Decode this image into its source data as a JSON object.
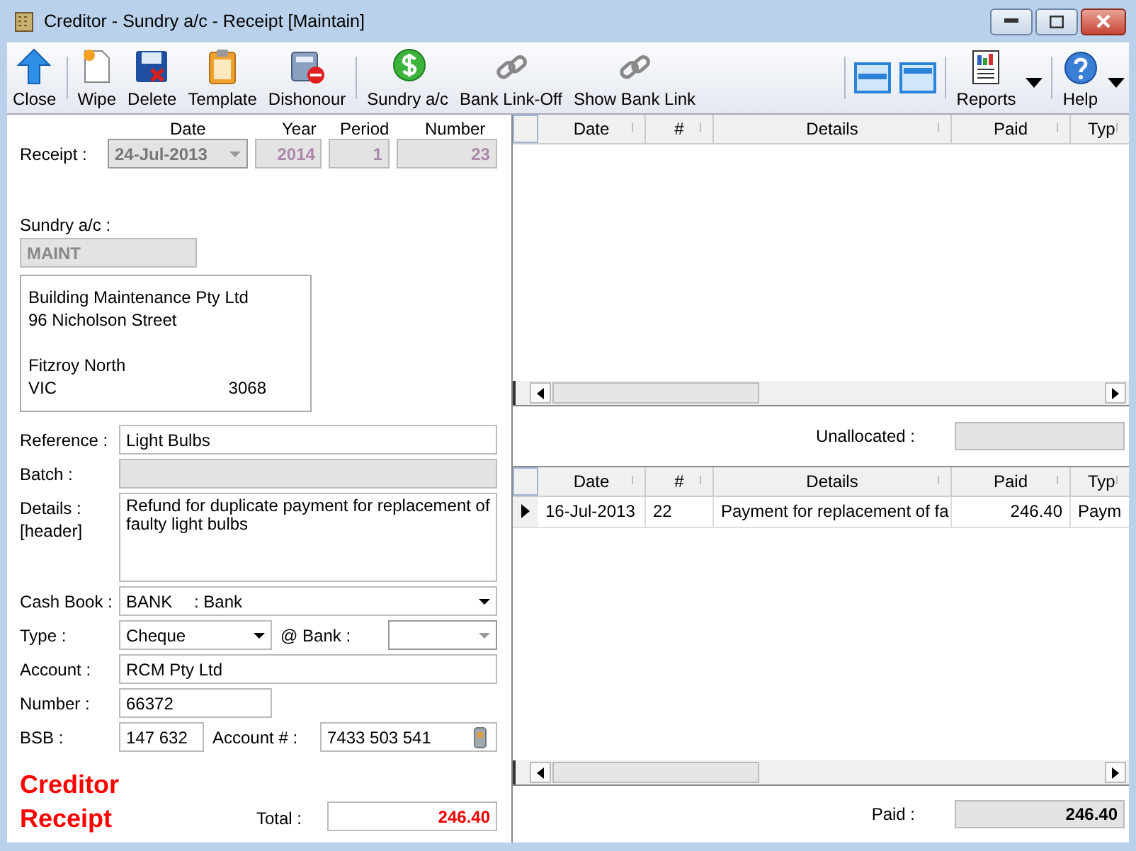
{
  "window": {
    "title": "Creditor - Sundry a/c - Receipt [Maintain]"
  },
  "toolbar": {
    "groups": [
      [
        {
          "label": "Close"
        }
      ],
      [
        {
          "label": "Wipe"
        },
        {
          "label": "Delete"
        },
        {
          "label": "Template"
        },
        {
          "label": "Dishonour"
        }
      ],
      [
        {
          "label": "Sundry a/c"
        },
        {
          "label": "Bank Link-Off"
        },
        {
          "label": "Show Bank Link"
        }
      ]
    ],
    "right": [
      {
        "label": "Reports"
      },
      {
        "label": "Help"
      }
    ]
  },
  "receipt": {
    "label": "Receipt :",
    "headers": [
      "Date",
      "Year",
      "Period",
      "Number"
    ],
    "date": "24-Jul-2013",
    "year": "2014",
    "period": "1",
    "number": "23"
  },
  "sundry": {
    "label": "Sundry a/c :",
    "code": "MAINT",
    "name": "Building Maintenance Pty Ltd",
    "street": "96 Nicholson Street",
    "suburb": "Fitzroy North",
    "state": "VIC",
    "postcode": "3068"
  },
  "form": {
    "reference_label": "Reference :",
    "reference": "Light Bulbs",
    "batch_label": "Batch :",
    "details_label": "Details :",
    "details_sub": "[header]",
    "details": "Refund for duplicate payment for replacement of faulty light bulbs",
    "cash_book_label": "Cash Book :",
    "cash_book_code": "BANK",
    "cash_book_name": ": Bank",
    "type_label": "Type :",
    "type": "Cheque",
    "bank_label": "@ Bank :",
    "account_label": "Account :",
    "account": "RCM Pty Ltd",
    "number_label": "Number :",
    "number": "66372",
    "bsb_label": "BSB :",
    "bsb": "147 632",
    "account_no_label": "Account # :",
    "account_no": "7433 503 541"
  },
  "branding": [
    "Creditor",
    "Receipt"
  ],
  "total": {
    "label": "Total :",
    "value": "246.40"
  },
  "upper_grid": {
    "columns": [
      "Date",
      "#",
      "Details",
      "Paid",
      "Typ"
    ]
  },
  "unallocated": {
    "label": "Unallocated :"
  },
  "lower_grid": {
    "columns": [
      "Date",
      "#",
      "Details",
      "Paid",
      "Typ"
    ],
    "rows": [
      {
        "date": "16-Jul-2013",
        "number": "22",
        "details": "Payment for replacement of fa",
        "paid": "246.40",
        "type": "Paym",
        "selected": true
      }
    ]
  },
  "paid": {
    "label": "Paid :",
    "value": "246.40"
  }
}
